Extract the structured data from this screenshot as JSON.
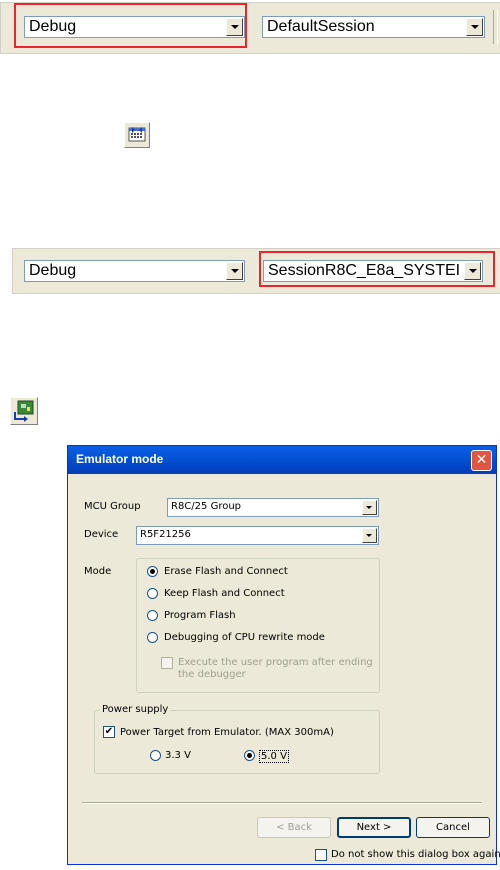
{
  "toolbar1": {
    "config_value": "Debug",
    "session_value": "DefaultSession"
  },
  "toolbar2": {
    "config_value": "Debug",
    "session_value": "SessionR8C_E8a_SYSTEI"
  },
  "icons": {
    "connect_icon": "connect-icon",
    "emulator_icon": "emulator-icon"
  },
  "dialog": {
    "title": "Emulator mode",
    "mcu_group_label": "MCU Group",
    "mcu_group_value": "R8C/25 Group",
    "device_label": "Device",
    "device_value": "R5F21256",
    "mode_label": "Mode",
    "mode_options": [
      "Erase Flash and Connect",
      "Keep Flash and Connect",
      "Program Flash",
      "Debugging of CPU rewrite mode"
    ],
    "mode_selected": 0,
    "execute_option_line1": "Execute the user program after ending",
    "execute_option_line2": "the debugger",
    "power_group_label": "Power supply",
    "power_target_label": "Power Target from Emulator. (MAX 300mA)",
    "power_target_checked": true,
    "voltage_options": [
      "3.3 V",
      "5.0 V"
    ],
    "voltage_selected": 1,
    "back_label": "< Back",
    "next_label": "Next >",
    "cancel_label": "Cancel",
    "dont_show_label": "Do not show this dialog box again."
  },
  "colors": {
    "highlight": "#e8262c",
    "titlebar": "#0653d6"
  }
}
